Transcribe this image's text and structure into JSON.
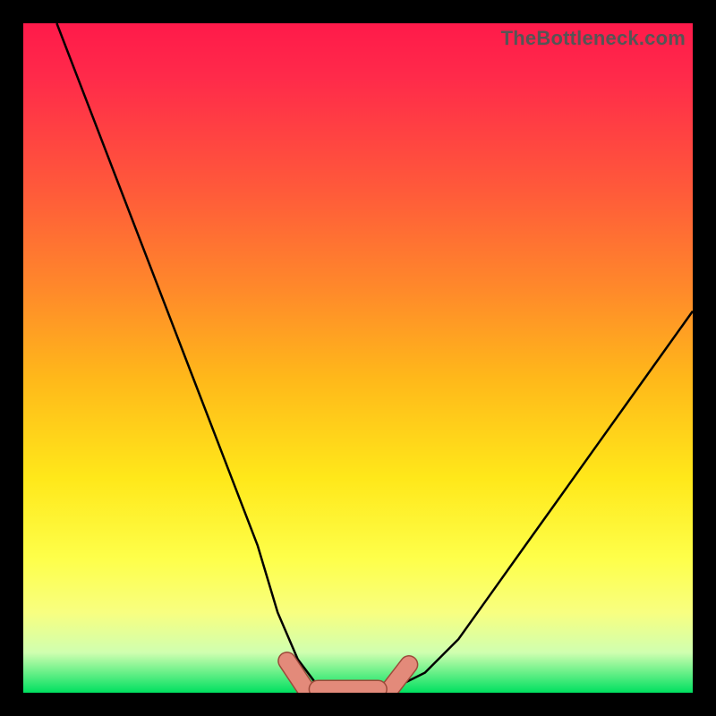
{
  "watermark": "TheBottleneck.com",
  "chart_data": {
    "type": "line",
    "title": "",
    "xlabel": "",
    "ylabel": "",
    "xlim": [
      0,
      100
    ],
    "ylim": [
      0,
      100
    ],
    "series": [
      {
        "name": "bottleneck-curve",
        "x": [
          5,
          10,
          15,
          20,
          25,
          30,
          35,
          38,
          41,
          44,
          47,
          50,
          53,
          56,
          60,
          65,
          70,
          75,
          80,
          85,
          90,
          95,
          100
        ],
        "values": [
          100,
          87,
          74,
          61,
          48,
          35,
          22,
          12,
          5,
          1,
          0,
          0,
          0,
          1,
          3,
          8,
          15,
          22,
          29,
          36,
          43,
          50,
          57
        ]
      }
    ],
    "annotations": [
      {
        "name": "marker-left",
        "x": 41,
        "y": 1
      },
      {
        "name": "marker-right",
        "x": 56,
        "y": 1
      },
      {
        "name": "bottom-bar",
        "x_range": [
          44,
          53
        ],
        "y": 0
      }
    ],
    "colors": {
      "curve": "#000000",
      "markers": "#e38a7a",
      "marker_stroke": "#9c4a3a",
      "gradient_top": "#ff1a4a",
      "gradient_bottom": "#00e060",
      "frame": "#000000"
    }
  }
}
